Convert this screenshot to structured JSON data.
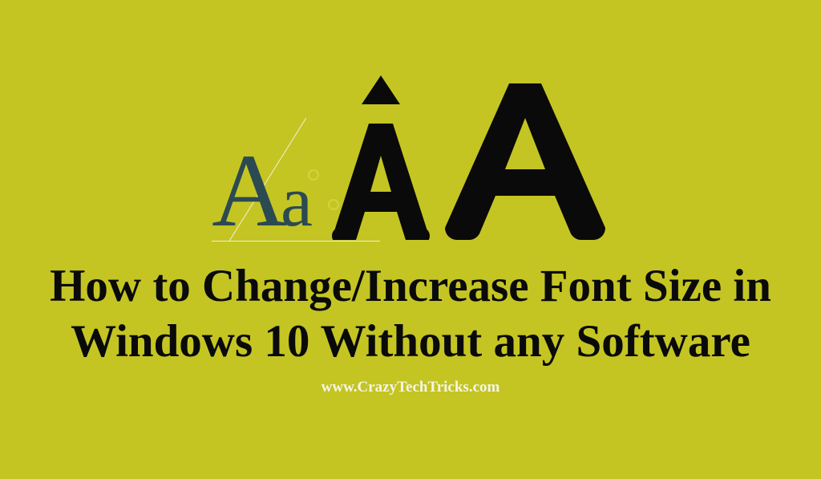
{
  "hero": {
    "serif_capital": "A",
    "serif_lowercase": "a"
  },
  "title": "How to Change/Increase Font Size in Windows 10 Without any Software",
  "website": "www.CrazyTechTricks.com"
}
